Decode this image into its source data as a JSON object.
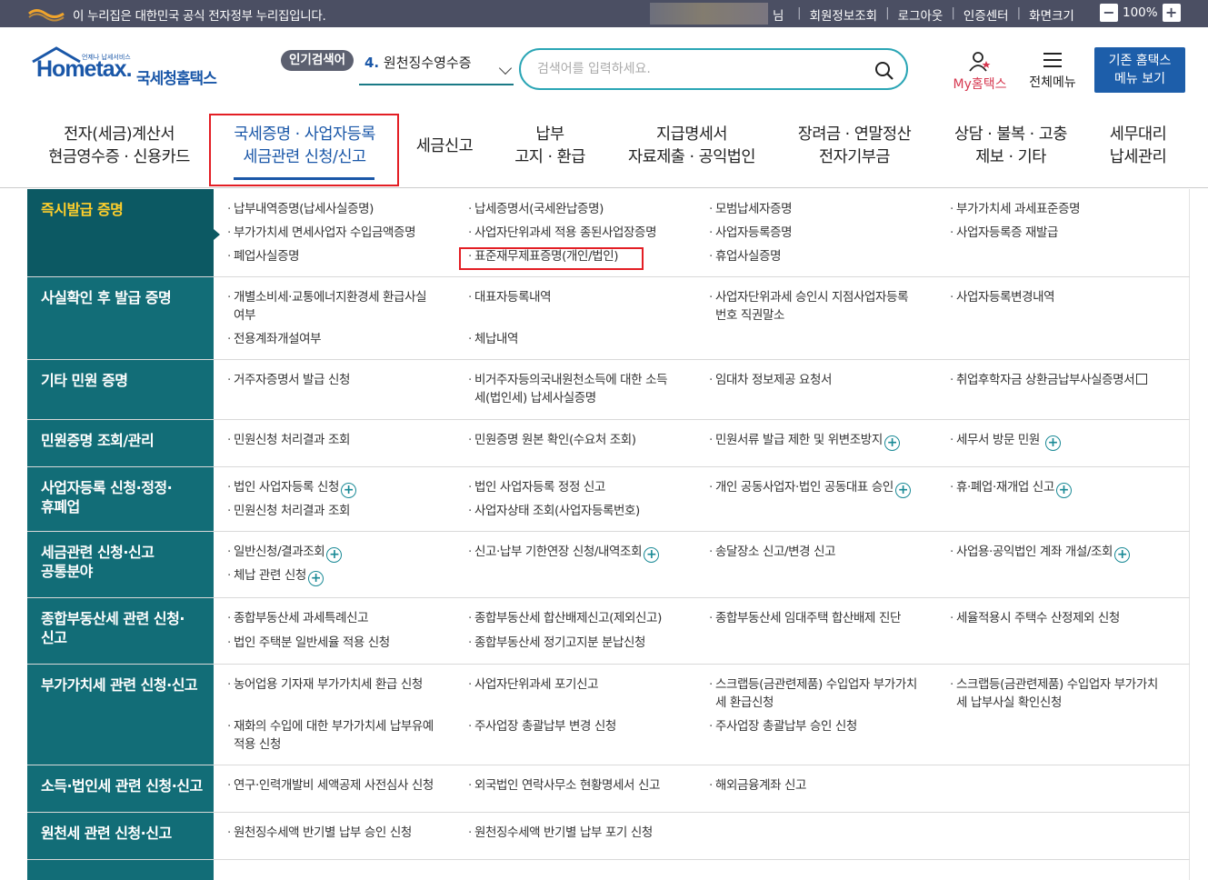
{
  "topbar": {
    "notice": "이 누리집은 대한민국 공식 전자정부 누리집입니다.",
    "user_suffix": "님",
    "links": [
      "회원정보조회",
      "로그아웃",
      "인증센터",
      "화면크기"
    ],
    "zoom_minus": "−",
    "zoom_value": "100%",
    "zoom_plus": "+"
  },
  "logo": {
    "eng": "Hometax.",
    "kor": "국세청홈택스",
    "tagline": "언제나 납세서비스"
  },
  "popular": {
    "badge": "인기검색어",
    "rank": "4.",
    "keyword": "원천징수영수증"
  },
  "search": {
    "placeholder": "검색어를 입력하세요."
  },
  "util": {
    "my_hometax": "My홈택스",
    "all_menu": "전체메뉴",
    "old_home_line1": "기존 홈택스",
    "old_home_line2": "메뉴 보기"
  },
  "gnb": [
    {
      "line1": "전자(세금)계산서",
      "line2": "현금영수증 · 신용카드"
    },
    {
      "line1": "국세증명 · 사업자등록",
      "line2": "세금관련 신청/신고"
    },
    {
      "line1": "세금신고",
      "line2": ""
    },
    {
      "line1": "납부",
      "line2": "고지 · 환급"
    },
    {
      "line1": "지급명세서",
      "line2": "자료제출 · 공익법인"
    },
    {
      "line1": "장려금 · 연말정산",
      "line2": "전자기부금"
    },
    {
      "line1": "상담 · 불복 · 고충",
      "line2": "제보 · 기타"
    },
    {
      "line1": "세무대리",
      "line2": "납세관리"
    }
  ],
  "sections": [
    {
      "title": "즉시발급 증명",
      "items": [
        "납부내역증명(납세사실증명)",
        "납세증명서(국세완납증명)",
        "모범납세자증명",
        "부가가치세 과세표준증명",
        "부가가치세 면세사업자 수입금액증명",
        "사업자단위과세 적용 종된사업장증명",
        "사업자등록증명",
        "사업자등록증 재발급",
        "폐업사실증명",
        "표준재무제표증명(개인/법인)",
        "휴업사실증명"
      ]
    },
    {
      "title": "사실확인 후 발급 증명",
      "items": [
        "개별소비세·교통에너지환경세 환급사실",
        "여부",
        "대표자등록내역",
        "사업자단위과세 승인시 지점사업자등록",
        "번호 직권말소",
        "사업자등록변경내역",
        "전용계좌개설여부",
        "체납내역"
      ]
    },
    {
      "title": "기타 민원 증명",
      "items": [
        "거주자증명서 발급 신청",
        "비거주자등의국내원천소득에 대한 소득",
        "세(법인세) 납세사실증명",
        "임대차 정보제공 요청서",
        "취업후학자금 상환금납부사실증명서"
      ]
    },
    {
      "title": "민원증명 조회/관리",
      "items": [
        "민원신청 처리결과 조회",
        "민원증명 원본 확인(수요처 조회)",
        "민원서류 발급 제한 및 위변조방지",
        "세무서 방문 민원"
      ]
    },
    {
      "title1": "사업자등록 신청·정정·",
      "title2": "휴폐업",
      "items": [
        "법인 사업자등록 신청",
        "법인 사업자등록 정정 신고",
        "개인 공동사업자·법인 공동대표 승인",
        "휴·폐업·재개업 신고",
        "민원신청 처리결과 조회",
        "사업자상태 조회(사업자등록번호)"
      ]
    },
    {
      "title1": "세금관련 신청·신고",
      "title2": "공통분야",
      "items": [
        "일반신청/결과조회",
        "신고·납부 기한연장 신청/내역조회",
        "송달장소 신고/변경 신고",
        "사업용·공익법인 계좌 개설/조회",
        "체납 관련 신청"
      ]
    },
    {
      "title1": "종합부동산세 관련 신청·",
      "title2": "신고",
      "items": [
        "종합부동산세 과세특례신고",
        "종합부동산세 합산배제신고(제외신고)",
        "종합부동산세 임대주택 합산배제 진단",
        "세율적용시 주택수 산정제외 신청",
        "법인 주택분 일반세율 적용 신청",
        "종합부동산세 정기고지분 분납신청"
      ]
    },
    {
      "title": "부가가치세 관련 신청·신고",
      "items": [
        "농어업용 기자재 부가가치세 환급 신청",
        "사업자단위과세 포기신고",
        "스크랩등(금관련제품) 수입업자 부가가치",
        "세 환급신청",
        "스크랩등(금관련제품) 수입업자 부가가치",
        "세 납부사실 확인신청",
        "재화의 수입에 대한 부가가치세 납부유예",
        "적용 신청",
        "주사업장 총괄납부 변경 신청",
        "주사업장 총괄납부 승인 신청"
      ]
    },
    {
      "title": "소득·법인세 관련 신청·신고",
      "items": [
        "연구·인력개발비 세액공제 사전심사 신청",
        "외국법인 연락사무소 현황명세서 신고",
        "해외금융계좌 신고"
      ]
    },
    {
      "title": "원천세 관련 신청·신고",
      "items": [
        "원천징수세액 반기별 납부 승인 신청",
        "원천징수세액 반기별 납부 포기 신청"
      ]
    }
  ]
}
